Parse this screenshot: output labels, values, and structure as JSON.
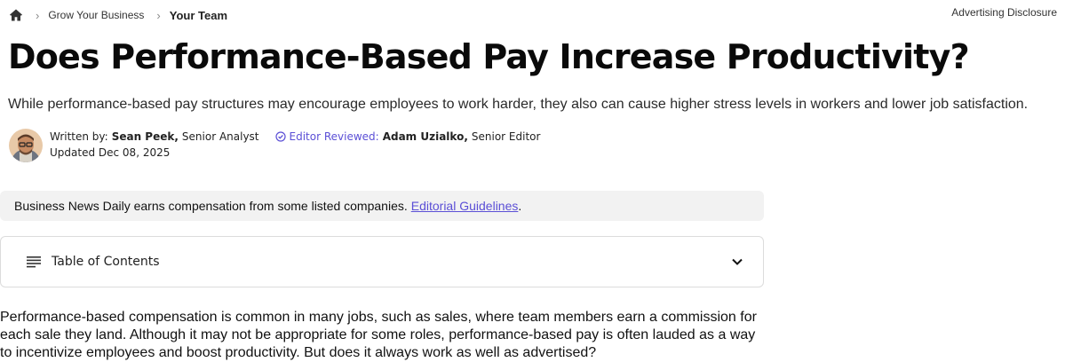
{
  "breadcrumb": {
    "home_icon": "home-icon",
    "items": [
      "Grow Your Business",
      "Your Team"
    ]
  },
  "header": {
    "ad_disclosure": "Advertising Disclosure"
  },
  "article": {
    "title": "Does Performance-Based Pay Increase Productivity?",
    "subtitle": "While performance-based pay structures may encourage employees to work harder, they also can cause higher stress levels in workers and lower job satisfaction.",
    "author": {
      "written_by_label": "Written by:",
      "name": "Sean Peek,",
      "role": "Senior Analyst",
      "reviewed_label": "Editor Reviewed:",
      "editor_name": "Adam Uzialko,",
      "editor_role": "Senior Editor",
      "updated": "Updated Dec 08, 2025"
    },
    "disclaimer": {
      "text": "Business News Daily earns compensation from some listed companies.",
      "link": "Editorial Guidelines",
      "tail": "."
    },
    "toc": {
      "label": "Table of Contents"
    },
    "body": "Performance-based compensation is common in many jobs, such as sales, where team members earn a commission for each sale they land. Although it may not be appropriate for some roles, performance-based pay is often lauded as a way to incentivize employees and boost productivity. But does it always work as well as advertised?"
  },
  "colors": {
    "accent": "#5b4fd6",
    "disclaimer_bg": "#f2f2f2"
  }
}
